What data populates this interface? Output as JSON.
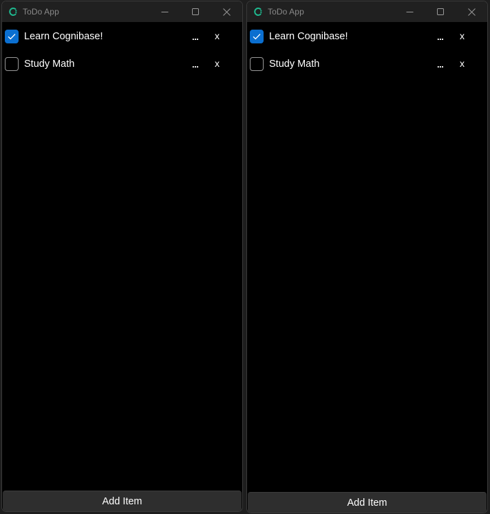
{
  "windows": [
    {
      "title": "ToDo App",
      "items": [
        {
          "label": "Learn Cognibase!",
          "checked": true,
          "more_label": "...",
          "delete_label": "x"
        },
        {
          "label": "Study Math",
          "checked": false,
          "more_label": "...",
          "delete_label": "x"
        }
      ],
      "add_button_label": "Add Item"
    },
    {
      "title": "ToDo App",
      "items": [
        {
          "label": "Learn Cognibase!",
          "checked": true,
          "more_label": "...",
          "delete_label": "x"
        },
        {
          "label": "Study Math",
          "checked": false,
          "more_label": "...",
          "delete_label": "x"
        }
      ],
      "add_button_label": "Add Item"
    }
  ],
  "icons": {
    "app": "cognibase-logo-icon",
    "minimize": "minimize-icon",
    "maximize": "maximize-icon",
    "close": "close-icon",
    "check": "checkmark-icon"
  },
  "colors": {
    "accent_teal": "#1fb98f",
    "checkbox_checked": "#0b6fd0",
    "window_bg": "#000000",
    "titlebar_bg": "#202020",
    "button_bg": "#2e2e2e"
  }
}
